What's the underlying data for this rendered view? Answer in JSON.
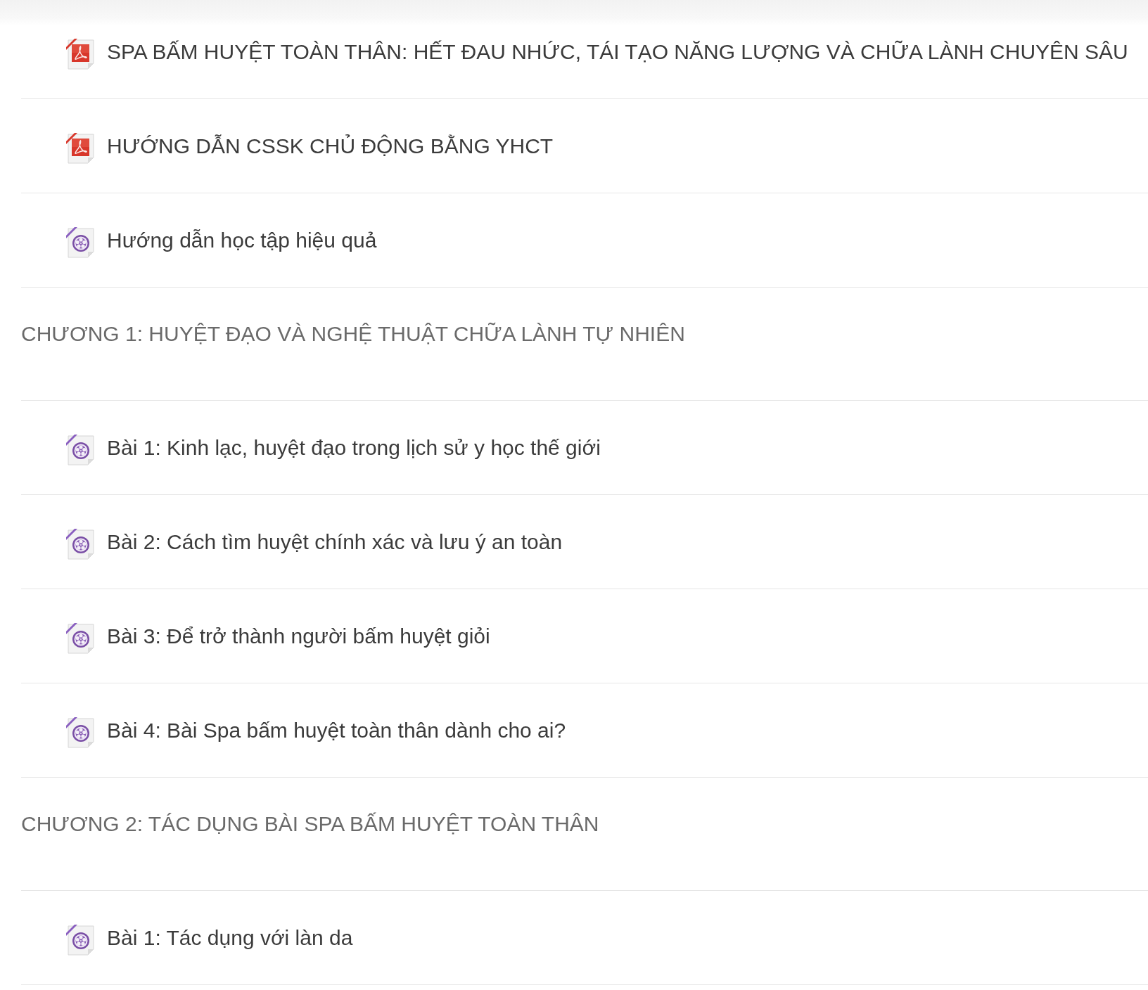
{
  "items": [
    {
      "kind": "pdf",
      "title": "SPA BẤM HUYỆT TOÀN THÂN: HẾT ĐAU NHỨC, TÁI TẠO NĂNG LƯỢNG VÀ CHỮA LÀNH CHUYÊN SÂU"
    },
    {
      "kind": "pdf",
      "title": "HƯỚNG DẪN CSSK CHỦ ĐỘNG BẰNG YHCT"
    },
    {
      "kind": "video",
      "title": "Hướng dẫn học tập hiệu quả"
    },
    {
      "kind": "section",
      "title": "CHƯƠNG 1: HUYỆT ĐẠO VÀ NGHỆ THUẬT CHỮA LÀNH TỰ NHIÊN"
    },
    {
      "kind": "video",
      "title": "Bài 1: Kinh lạc, huyệt đạo trong lịch sử y học thế giới"
    },
    {
      "kind": "video",
      "title": "Bài 2: Cách tìm huyệt chính xác và lưu ý an toàn"
    },
    {
      "kind": "video",
      "title": "Bài 3: Để trở thành người bấm huyệt giỏi"
    },
    {
      "kind": "video",
      "title": "Bài 4: Bài Spa bấm huyệt toàn thân dành cho ai?"
    },
    {
      "kind": "section",
      "title": "CHƯƠNG 2: TÁC DỤNG BÀI SPA BẤM HUYỆT TOÀN THÂN"
    },
    {
      "kind": "video",
      "title": "Bài 1: Tác dụng với làn da"
    }
  ]
}
